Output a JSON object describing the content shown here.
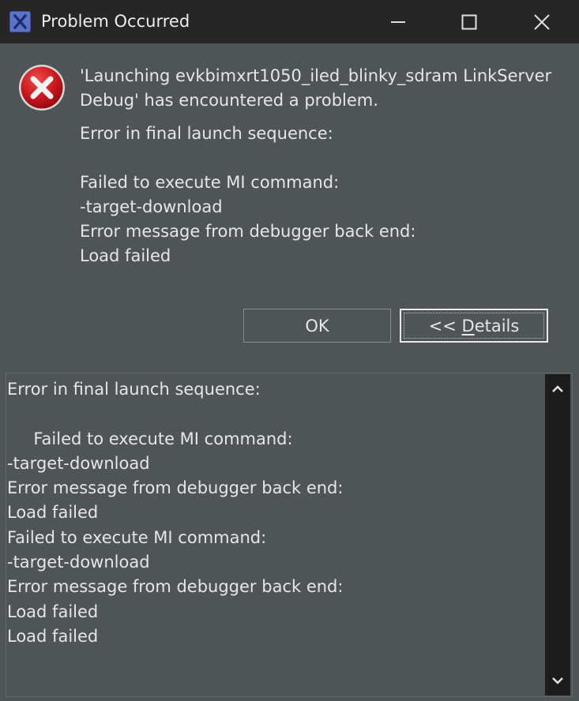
{
  "window": {
    "title": "Problem Occurred",
    "app_icon": "eclipse-x-icon",
    "controls": [
      "minimize-icon",
      "maximize-icon",
      "close-icon"
    ]
  },
  "dialog": {
    "icon": "error-icon",
    "icon_color": "#C8161D",
    "message": {
      "headline_line1": "'Launching evkbimxrt1050_iled_blinky_sdram LinkServer",
      "headline_line2": "Debug' has encountered a problem.",
      "reason": "Error in final launch sequence:",
      "detail_lines": [
        "Failed to execute MI command:",
        "-target-download",
        "Error message from debugger back end:",
        "Load failed"
      ]
    },
    "buttons": {
      "ok_label": "OK",
      "details_prefix": "<< ",
      "details_mnemonic": "D",
      "details_rest": "etails"
    },
    "details_text": "Error in final launch sequence:\n\n     Failed to execute MI command:\n-target-download\nError message from debugger back end:\nLoad failed\nFailed to execute MI command:\n-target-download\nError message from debugger back end:\nLoad failed\nLoad failed"
  },
  "colors": {
    "titlebar_bg": "#262626",
    "body_bg": "#4F5457",
    "text": "#E6E6E6",
    "scrollbar_bg": "#1C1C1C",
    "app_icon_bg": "#5B74C8"
  }
}
